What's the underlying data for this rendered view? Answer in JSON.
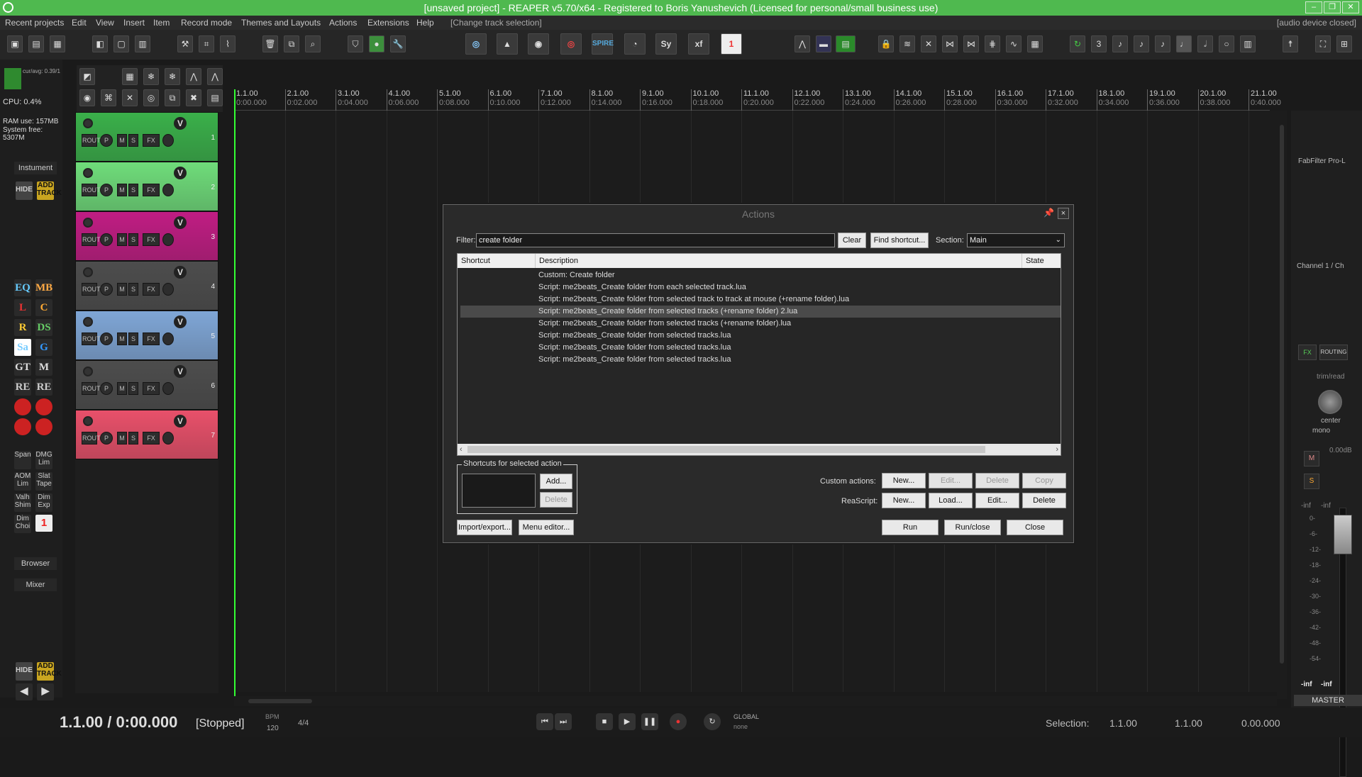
{
  "window": {
    "title": "[unsaved project] - REAPER v5.70/x64 - Registered to Boris Yanushevich (Licensed for personal/small business use)"
  },
  "menu": {
    "items": [
      "Recent projects",
      "Edit",
      "View",
      "Insert",
      "Item",
      "Record mode",
      "Themes and Layouts",
      "Actions",
      "Extensions",
      "Help",
      "[Change track selection]"
    ],
    "status_right": "[audio device closed]"
  },
  "left_panel": {
    "cpu_meter": "cur/avg: 0.39/1",
    "cpu": "CPU: 0.4%",
    "ram": "RAM use: 157MB",
    "system_free": "System free: 5307M",
    "instrument_label": "Instument",
    "hide_label": "HIDE",
    "add_track_label": "ADD TRACK",
    "plugin_labels": [
      "EQ",
      "MB",
      "L",
      "C",
      "R",
      "DS",
      "Sa",
      "G",
      "GT",
      "M",
      "RE",
      "RE"
    ],
    "plugin_small": [
      "Span",
      "DMG Lim",
      "AOM Lim",
      "Slat Tape",
      "Valh Shim",
      "Dim Exp",
      "Dim Choi"
    ],
    "browser_label": "Browser",
    "mixer_label": "Mixer",
    "badge_one": "1"
  },
  "tracks": [
    {
      "num": "1",
      "color": "#3ab04a"
    },
    {
      "num": "2",
      "color": "#6fdc7a"
    },
    {
      "num": "3",
      "color": "#c01d83"
    },
    {
      "num": "4",
      "color": "#4d4d4d"
    },
    {
      "num": "5",
      "color": "#7fa6d6"
    },
    {
      "num": "6",
      "color": "#4d4d4d"
    },
    {
      "num": "7",
      "color": "#e8506a"
    }
  ],
  "track_controls": {
    "route": "ROUTE",
    "m": "M",
    "s": "S",
    "fx": "FX",
    "v": "V"
  },
  "ruler": [
    {
      "bar": "1.1.00",
      "time": "0:00.000"
    },
    {
      "bar": "2.1.00",
      "time": "0:02.000"
    },
    {
      "bar": "3.1.00",
      "time": "0:04.000"
    },
    {
      "bar": "4.1.00",
      "time": "0:06.000"
    },
    {
      "bar": "5.1.00",
      "time": "0:08.000"
    },
    {
      "bar": "6.1.00",
      "time": "0:10.000"
    },
    {
      "bar": "7.1.00",
      "time": "0:12.000"
    },
    {
      "bar": "8.1.00",
      "time": "0:14.000"
    },
    {
      "bar": "9.1.00",
      "time": "0:16.000"
    },
    {
      "bar": "10.1.00",
      "time": "0:18.000"
    },
    {
      "bar": "11.1.00",
      "time": "0:20.000"
    },
    {
      "bar": "12.1.00",
      "time": "0:22.000"
    },
    {
      "bar": "13.1.00",
      "time": "0:24.000"
    },
    {
      "bar": "14.1.00",
      "time": "0:26.000"
    },
    {
      "bar": "15.1.00",
      "time": "0:28.000"
    },
    {
      "bar": "16.1.00",
      "time": "0:30.000"
    },
    {
      "bar": "17.1.00",
      "time": "0:32.000"
    },
    {
      "bar": "18.1.00",
      "time": "0:34.000"
    },
    {
      "bar": "19.1.00",
      "time": "0:36.000"
    },
    {
      "bar": "20.1.00",
      "time": "0:38.000"
    },
    {
      "bar": "21.1.00",
      "time": "0:40.000"
    }
  ],
  "mixer": {
    "plugin": "FabFilter Pro-L",
    "channel": "Channel 1 / Ch",
    "fx": "FX",
    "routing": "ROUTING",
    "trim": "trim/read",
    "pan": "center",
    "mono": "mono",
    "volume": "0.00dB",
    "m": "M",
    "s": "S",
    "db_ticks": [
      "-inf",
      "-inf",
      "0-",
      "-6-",
      "-12-",
      "-18-",
      "-24-",
      "-30-",
      "-36-",
      "-42-",
      "-48-",
      "-54-"
    ],
    "peak_l": "-inf",
    "peak_r": "-inf",
    "master": "MASTER"
  },
  "transport": {
    "position": "1.1.00 / 0:00.000",
    "state": "[Stopped]",
    "bpm_label": "BPM",
    "bpm": "120",
    "timesig": "4/4",
    "global": "GLOBAL",
    "global_mode": "none",
    "selection_label": "Selection:",
    "sel_start": "1.1.00",
    "sel_end": "1.1.00",
    "sel_len": "0.00.000"
  },
  "actions_dialog": {
    "title": "Actions",
    "filter_label": "Filter:",
    "filter_value": "create folder",
    "clear": "Clear",
    "find_shortcut": "Find shortcut...",
    "section_label": "Section:",
    "section_value": "Main",
    "columns": {
      "shortcut": "Shortcut",
      "description": "Description",
      "state": "State"
    },
    "rows": [
      "Custom: Create folder",
      "Script: me2beats_Create folder from each selected track.lua",
      "Script: me2beats_Create folder from selected track to track at mouse (+rename folder).lua",
      "Script: me2beats_Create folder from selected tracks (+rename folder) 2.lua",
      "Script: me2beats_Create folder from selected tracks (+rename folder).lua",
      "Script: me2beats_Create folder from selected tracks.lua",
      "Script: me2beats_Create folder from selected tracks.lua",
      "Script: me2beats_Create folder from selected tracks.lua"
    ],
    "selected_row": 3,
    "shortcuts_group": "Shortcuts for selected action",
    "add": "Add...",
    "delete": "Delete",
    "custom_actions_label": "Custom actions:",
    "reascript_label": "ReaScript:",
    "new": "New...",
    "edit": "Edit...",
    "copy": "Copy",
    "load": "Load...",
    "import_export": "Import/export...",
    "menu_editor": "Menu editor...",
    "run": "Run",
    "run_close": "Run/close",
    "close": "Close"
  }
}
